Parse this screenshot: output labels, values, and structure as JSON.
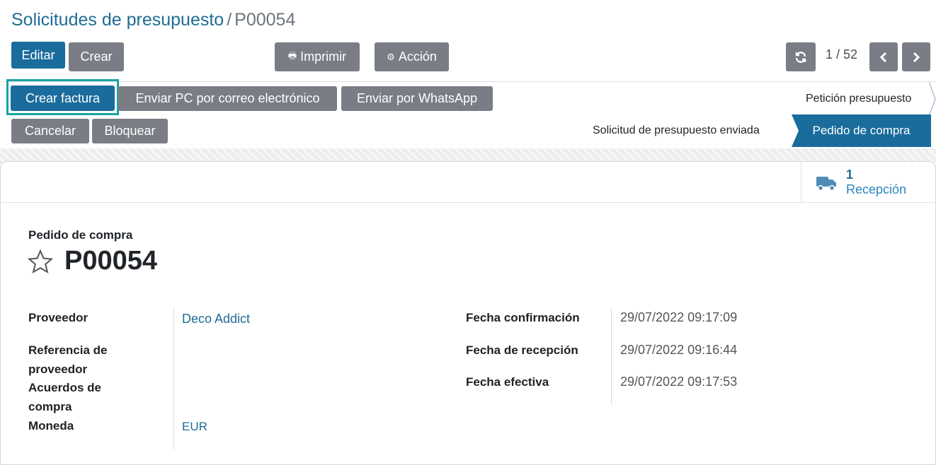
{
  "breadcrumb": {
    "parent": "Solicitudes de presupuesto",
    "separator": "/",
    "current": "P00054"
  },
  "toolbar": {
    "edit_label": "Editar",
    "create_label": "Crear",
    "print_label": "Imprimir",
    "action_label": "Acción"
  },
  "pager": {
    "value": "1 / 52"
  },
  "actions": {
    "create_invoice": "Crear factura",
    "send_email": "Enviar PC por correo electrónico",
    "send_whatsapp": "Enviar por WhatsApp",
    "cancel": "Cancelar",
    "lock": "Bloquear"
  },
  "statusbar": {
    "stages": [
      "Petición presupuesto",
      "Solicitud de presupuesto enviada",
      "Pedido de compra"
    ],
    "active": "Pedido de compra"
  },
  "smart_button": {
    "count": "1",
    "label": "Recepción",
    "icon": "truck-icon"
  },
  "form": {
    "type_label": "Pedido de compra",
    "name": "P00054",
    "left": [
      {
        "label": "Proveedor",
        "value": "Deco Addict"
      },
      {
        "label": "Referencia de proveedor",
        "value": ""
      },
      {
        "label": "Acuerdos de compra",
        "value": ""
      },
      {
        "label": "Moneda",
        "value": "EUR"
      }
    ],
    "right": [
      {
        "label": "Fecha confirmación",
        "value": "29/07/2022 09:17:09"
      },
      {
        "label": "Fecha de recepción",
        "value": "29/07/2022 09:16:44"
      },
      {
        "label": "Fecha efectiva",
        "value": "29/07/2022 09:17:53"
      }
    ]
  },
  "colors": {
    "primary": "#1a6c9c",
    "secondary": "#7a7d86",
    "highlight": "#17a2a2"
  }
}
